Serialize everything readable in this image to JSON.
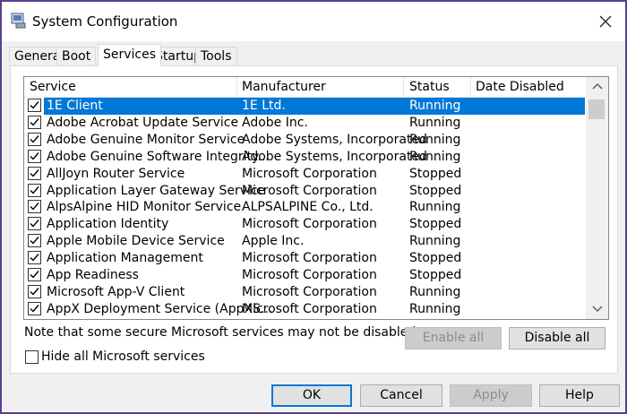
{
  "window": {
    "title": "System Configuration"
  },
  "tabs": [
    "General",
    "Boot",
    "Services",
    "Startup",
    "Tools"
  ],
  "table": {
    "headers": [
      "Service",
      "Manufacturer",
      "Status",
      "Date Disabled"
    ],
    "rows": [
      {
        "service": "1E Client",
        "manufacturer": "1E Ltd.",
        "status": "Running",
        "checked": true,
        "selected": true
      },
      {
        "service": "Adobe Acrobat Update Service",
        "manufacturer": "Adobe Inc.",
        "status": "Running",
        "checked": true
      },
      {
        "service": "Adobe Genuine Monitor Service",
        "manufacturer": "Adobe Systems, Incorporated",
        "status": "Running",
        "checked": true
      },
      {
        "service": "Adobe Genuine Software Integrity...",
        "manufacturer": "Adobe Systems, Incorporated",
        "status": "Running",
        "checked": true
      },
      {
        "service": "AllJoyn Router Service",
        "manufacturer": "Microsoft Corporation",
        "status": "Stopped",
        "checked": true
      },
      {
        "service": "Application Layer Gateway Service",
        "manufacturer": "Microsoft Corporation",
        "status": "Stopped",
        "checked": true
      },
      {
        "service": "AlpsAlpine HID Monitor Service",
        "manufacturer": "ALPSALPINE Co., Ltd.",
        "status": "Running",
        "checked": true
      },
      {
        "service": "Application Identity",
        "manufacturer": "Microsoft Corporation",
        "status": "Stopped",
        "checked": true
      },
      {
        "service": "Apple Mobile Device Service",
        "manufacturer": "Apple Inc.",
        "status": "Running",
        "checked": true
      },
      {
        "service": "Application Management",
        "manufacturer": "Microsoft Corporation",
        "status": "Stopped",
        "checked": true
      },
      {
        "service": "App Readiness",
        "manufacturer": "Microsoft Corporation",
        "status": "Stopped",
        "checked": true
      },
      {
        "service": "Microsoft App-V Client",
        "manufacturer": "Microsoft Corporation",
        "status": "Running",
        "checked": true
      },
      {
        "service": "AppX Deployment Service (AppXS...",
        "manufacturer": "Microsoft Corporation",
        "status": "Running",
        "checked": true
      }
    ]
  },
  "note": "Note that some secure Microsoft services may not be disabled.",
  "buttons": {
    "enable_all": "Enable all",
    "disable_all": "Disable all",
    "ok": "OK",
    "cancel": "Cancel",
    "apply": "Apply",
    "help": "Help"
  },
  "hide_ms": {
    "label": "Hide all Microsoft services",
    "checked": false
  },
  "colors": {
    "selection": "#0078d7",
    "window_border": "#5a3f8f"
  }
}
